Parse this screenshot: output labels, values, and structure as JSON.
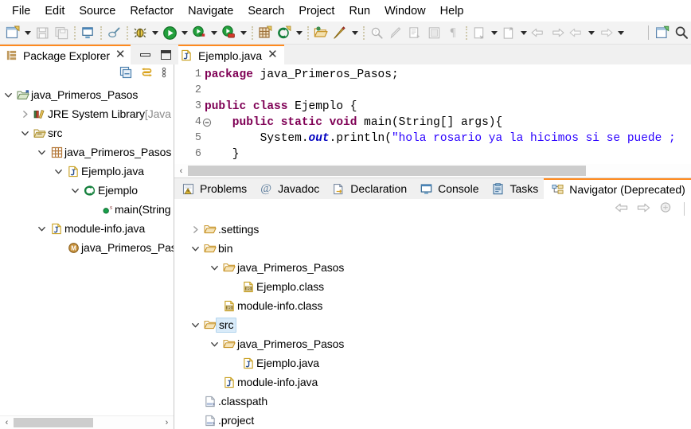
{
  "menubar": {
    "items": [
      {
        "label": "File"
      },
      {
        "label": "Edit"
      },
      {
        "label": "Source"
      },
      {
        "label": "Refactor"
      },
      {
        "label": "Navigate"
      },
      {
        "label": "Search"
      },
      {
        "label": "Project"
      },
      {
        "label": "Run"
      },
      {
        "label": "Window"
      },
      {
        "label": "Help"
      }
    ]
  },
  "toolbar": {
    "items": [
      {
        "name": "new-wizard-icon",
        "type": "icon"
      },
      {
        "name": "new-wizard-dropdown-arrow",
        "type": "arrow"
      },
      {
        "name": "save-icon",
        "type": "icon"
      },
      {
        "name": "save-all-icon",
        "type": "icon"
      },
      {
        "name": "separator",
        "type": "sep"
      },
      {
        "name": "print-icon",
        "type": "icon"
      },
      {
        "name": "separator",
        "type": "sep"
      },
      {
        "name": "quick-fix-icon",
        "type": "icon"
      },
      {
        "name": "separator",
        "type": "sep"
      },
      {
        "name": "debug-icon",
        "type": "icon"
      },
      {
        "name": "debug-dropdown-arrow",
        "type": "arrow"
      },
      {
        "name": "run-icon",
        "type": "icon"
      },
      {
        "name": "run-dropdown-arrow",
        "type": "arrow"
      },
      {
        "name": "run-coverage-icon",
        "type": "icon"
      },
      {
        "name": "run-coverage-dropdown-arrow",
        "type": "arrow"
      },
      {
        "name": "run-external-tools-icon",
        "type": "icon"
      },
      {
        "name": "run-external-tools-dropdown-arrow",
        "type": "arrow"
      },
      {
        "name": "separator",
        "type": "sep"
      },
      {
        "name": "new-java-package-icon",
        "type": "icon"
      },
      {
        "name": "new-java-class-icon",
        "type": "icon"
      },
      {
        "name": "new-java-class-dropdown-arrow",
        "type": "arrow"
      },
      {
        "name": "separator",
        "type": "sep"
      },
      {
        "name": "open-type-icon",
        "type": "icon"
      },
      {
        "name": "new-annotation-icon",
        "type": "icon"
      },
      {
        "name": "new-annotation-dropdown-arrow",
        "type": "arrow"
      },
      {
        "name": "separator",
        "type": "sep"
      },
      {
        "name": "search-references-icon",
        "type": "icon"
      },
      {
        "name": "skip-all-breakpoints-icon",
        "type": "icon"
      },
      {
        "name": "next-annotation-icon",
        "type": "icon"
      },
      {
        "name": "toggle-block-selection-icon",
        "type": "icon"
      },
      {
        "name": "show-whitespace-icon",
        "type": "icon"
      },
      {
        "name": "separator",
        "type": "sep"
      },
      {
        "name": "previous-edit-location-icon",
        "type": "icon"
      },
      {
        "name": "previous-edit-dropdown-arrow",
        "type": "arrow"
      },
      {
        "name": "next-edit-location-icon",
        "type": "icon"
      },
      {
        "name": "next-edit-dropdown-arrow",
        "type": "arrow"
      },
      {
        "name": "back-icon",
        "type": "icon"
      },
      {
        "name": "forward-icon",
        "type": "icon"
      },
      {
        "name": "previous-icon",
        "type": "icon"
      },
      {
        "name": "previous-dropdown-arrow",
        "type": "arrow"
      },
      {
        "name": "next-icon",
        "type": "icon"
      },
      {
        "name": "next-dropdown-arrow",
        "type": "arrow"
      },
      {
        "name": "separator-solid",
        "type": "sep-solid"
      },
      {
        "name": "open-perspective-icon",
        "type": "icon"
      },
      {
        "name": "search-icon",
        "type": "icon"
      }
    ]
  },
  "package_explorer": {
    "tab_label": "Package Explorer",
    "tab_icon": "package-explorer-icon",
    "close_label": "✕",
    "minimize_label": "minimize",
    "maximize_label": "maximize",
    "toolbar": [
      {
        "name": "collapse-all-icon"
      },
      {
        "name": "link-with-editor-icon"
      },
      {
        "name": "view-menu-icon"
      }
    ],
    "tree": [
      {
        "indent": 0,
        "twisty": "down",
        "icon": "java-project-icon",
        "label": "java_Primeros_Pasos",
        "dim": ""
      },
      {
        "indent": 1,
        "twisty": "right",
        "icon": "jre-library-icon",
        "label": "JRE System Library ",
        "dim": "[Java"
      },
      {
        "indent": 1,
        "twisty": "down",
        "icon": "source-folder-icon",
        "label": "src",
        "dim": ""
      },
      {
        "indent": 2,
        "twisty": "down",
        "icon": "package-icon",
        "label": "java_Primeros_Pasos",
        "dim": ""
      },
      {
        "indent": 3,
        "twisty": "down",
        "icon": "java-file-icon",
        "label": "Ejemplo.java",
        "dim": ""
      },
      {
        "indent": 4,
        "twisty": "down",
        "icon": "java-class-icon",
        "label": "Ejemplo",
        "dim": ""
      },
      {
        "indent": 5,
        "twisty": "none",
        "icon": "java-static-method-icon",
        "label": "main(String",
        "dim": ""
      },
      {
        "indent": 2,
        "twisty": "down",
        "icon": "java-file-icon",
        "label": "module-info.java",
        "dim": ""
      },
      {
        "indent": 3,
        "twisty": "none",
        "icon": "java-module-icon",
        "label": "java_Primeros_Pas",
        "dim": ""
      }
    ],
    "scrollbar": {
      "left_arrow": "‹",
      "right_arrow": "›"
    }
  },
  "editor": {
    "tab_label": "Ejemplo.java",
    "tab_icon": "java-file-icon",
    "close_label": "✕",
    "lines": [
      {
        "num": "1",
        "fold": false
      },
      {
        "num": "2",
        "fold": false
      },
      {
        "num": "3",
        "fold": false
      },
      {
        "num": "4",
        "fold": true
      },
      {
        "num": "5",
        "fold": false
      },
      {
        "num": "6",
        "fold": false
      }
    ],
    "code": [
      [
        {
          "t": "package",
          "c": "kw"
        },
        {
          "t": " java_Primeros_Pasos;",
          "c": "plain"
        }
      ],
      [],
      [
        {
          "t": "public class",
          "c": "kw"
        },
        {
          "t": " Ejemplo {",
          "c": "plain"
        }
      ],
      [
        {
          "t": "    public static void",
          "c": "kw"
        },
        {
          "t": " main(String[] args){",
          "c": "plain"
        }
      ],
      [
        {
          "t": "        System.",
          "c": "plain"
        },
        {
          "t": "out",
          "c": "fld"
        },
        {
          "t": ".println(",
          "c": "plain"
        },
        {
          "t": "\"hola rosario ya la hicimos si se puede ;",
          "c": "str"
        }
      ],
      [
        {
          "t": "    }",
          "c": "plain"
        }
      ]
    ],
    "scrollbar": {
      "left_arrow": "‹"
    }
  },
  "bottom_view": {
    "tabs": [
      {
        "label": "Problems",
        "icon": "problems-icon",
        "active": false
      },
      {
        "label": "Javadoc",
        "icon": "javadoc-icon",
        "active": false
      },
      {
        "label": "Declaration",
        "icon": "declaration-icon",
        "active": false
      },
      {
        "label": "Console",
        "icon": "console-icon",
        "active": false
      },
      {
        "label": "Tasks",
        "icon": "tasks-icon",
        "active": false
      },
      {
        "label": "Navigator (Deprecated)",
        "icon": "navigator-icon",
        "active": true
      }
    ],
    "close_label": "✕",
    "toolbar": [
      {
        "name": "back-icon"
      },
      {
        "name": "forward-icon"
      },
      {
        "name": "link-with-editor-icon"
      }
    ],
    "tree": [
      {
        "indent": 0,
        "twisty": "right",
        "icon": "folder-icon",
        "label": ".settings",
        "sel": false
      },
      {
        "indent": 0,
        "twisty": "down",
        "icon": "folder-icon",
        "label": "bin",
        "sel": false
      },
      {
        "indent": 1,
        "twisty": "down",
        "icon": "folder-icon",
        "label": "java_Primeros_Pasos",
        "sel": false
      },
      {
        "indent": 2,
        "twisty": "none",
        "icon": "class-file-icon",
        "label": "Ejemplo.class",
        "sel": false
      },
      {
        "indent": 1,
        "twisty": "none",
        "icon": "class-file-icon",
        "label": "module-info.class",
        "sel": false
      },
      {
        "indent": 0,
        "twisty": "down",
        "icon": "folder-icon",
        "label": "src",
        "sel": true
      },
      {
        "indent": 1,
        "twisty": "down",
        "icon": "folder-icon",
        "label": "java_Primeros_Pasos",
        "sel": false
      },
      {
        "indent": 2,
        "twisty": "none",
        "icon": "java-file-icon",
        "label": "Ejemplo.java",
        "sel": false
      },
      {
        "indent": 1,
        "twisty": "none",
        "icon": "java-file-icon",
        "label": "module-info.java",
        "sel": false
      },
      {
        "indent": 0,
        "twisty": "none",
        "icon": "xml-file-icon",
        "label": ".classpath",
        "sel": false
      },
      {
        "indent": 0,
        "twisty": "none",
        "icon": "xml-file-icon",
        "label": ".project",
        "sel": false
      }
    ]
  },
  "colors": {
    "active_tab_top": "#ff8a1e",
    "selection_fill": "#d9ebf9",
    "selection_border": "#b4d5ee",
    "keyword": "#7f0055",
    "string": "#2a00ff",
    "field": "#0000c0",
    "tab_strip": "#f0f0f0"
  }
}
